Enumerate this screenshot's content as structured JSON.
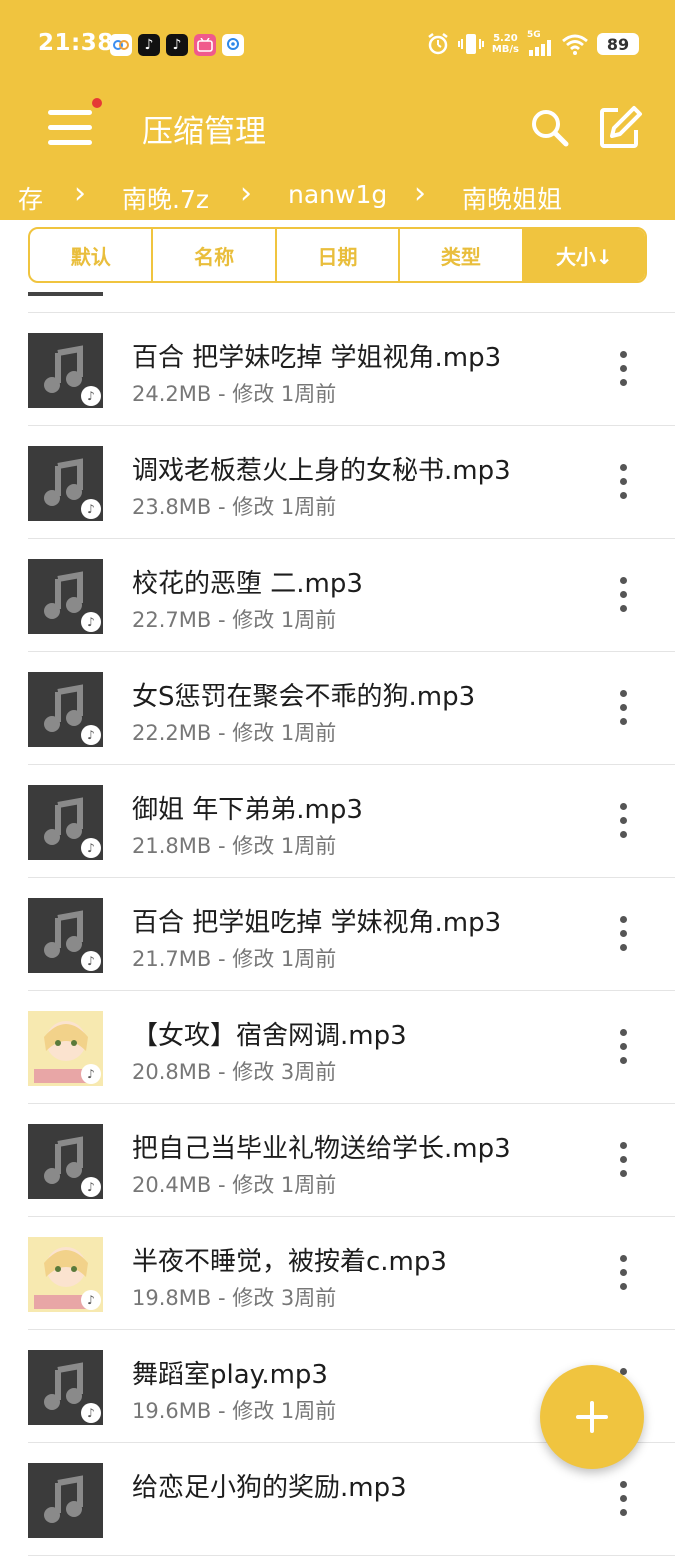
{
  "status_bar": {
    "time": "21:38",
    "net_speed_value": "5.20",
    "net_speed_unit": "MB/s",
    "network": "5G",
    "battery": "89",
    "notification_icons": [
      "baidu-netdisk-icon",
      "tiktok-icon",
      "tiktok-icon",
      "bilibili-icon",
      "location-icon"
    ]
  },
  "toolbar": {
    "title": "压缩管理",
    "has_notification_dot": true,
    "accent_color": "#f0c43f"
  },
  "breadcrumb": [
    "存",
    "南晚.7z",
    "nanw1g",
    "南晚姐姐"
  ],
  "sort_tabs": [
    {
      "label": "默认"
    },
    {
      "label": "名称"
    },
    {
      "label": "日期"
    },
    {
      "label": "类型"
    },
    {
      "label": "大小↓",
      "active": true
    }
  ],
  "files": [
    {
      "name": "百合 把学妹吃掉 学姐视角.mp3",
      "meta": "24.2MB - 修改 1周前",
      "thumb": "music-icon"
    },
    {
      "name": "调戏老板惹火上身的女秘书.mp3",
      "meta": "23.8MB - 修改 1周前",
      "thumb": "music-icon"
    },
    {
      "name": "校花的恶堕 二.mp3",
      "meta": "22.7MB - 修改 1周前",
      "thumb": "music-icon"
    },
    {
      "name": "女S惩罚在聚会不乖的狗.mp3",
      "meta": "22.2MB - 修改 1周前",
      "thumb": "music-icon"
    },
    {
      "name": "御姐 年下弟弟.mp3",
      "meta": "21.8MB - 修改 1周前",
      "thumb": "music-icon"
    },
    {
      "name": "百合 把学姐吃掉 学妹视角.mp3",
      "meta": "21.7MB - 修改 1周前",
      "thumb": "music-icon"
    },
    {
      "name": "【女攻】宿舍网调.mp3",
      "meta": "20.8MB - 修改 3周前",
      "thumb": "album-cover"
    },
    {
      "name": "把自己当毕业礼物送给学长.mp3",
      "meta": "20.4MB - 修改 1周前",
      "thumb": "music-icon"
    },
    {
      "name": "半夜不睡觉，被按着c.mp3",
      "meta": "19.8MB - 修改 3周前",
      "thumb": "album-cover"
    },
    {
      "name": "舞蹈室play.mp3",
      "meta": "19.6MB - 修改 1周前",
      "thumb": "music-icon"
    },
    {
      "name": "给恋足小狗的奖励.mp3",
      "meta": "",
      "thumb": "music-icon"
    }
  ],
  "fab_icon": "plus-icon"
}
